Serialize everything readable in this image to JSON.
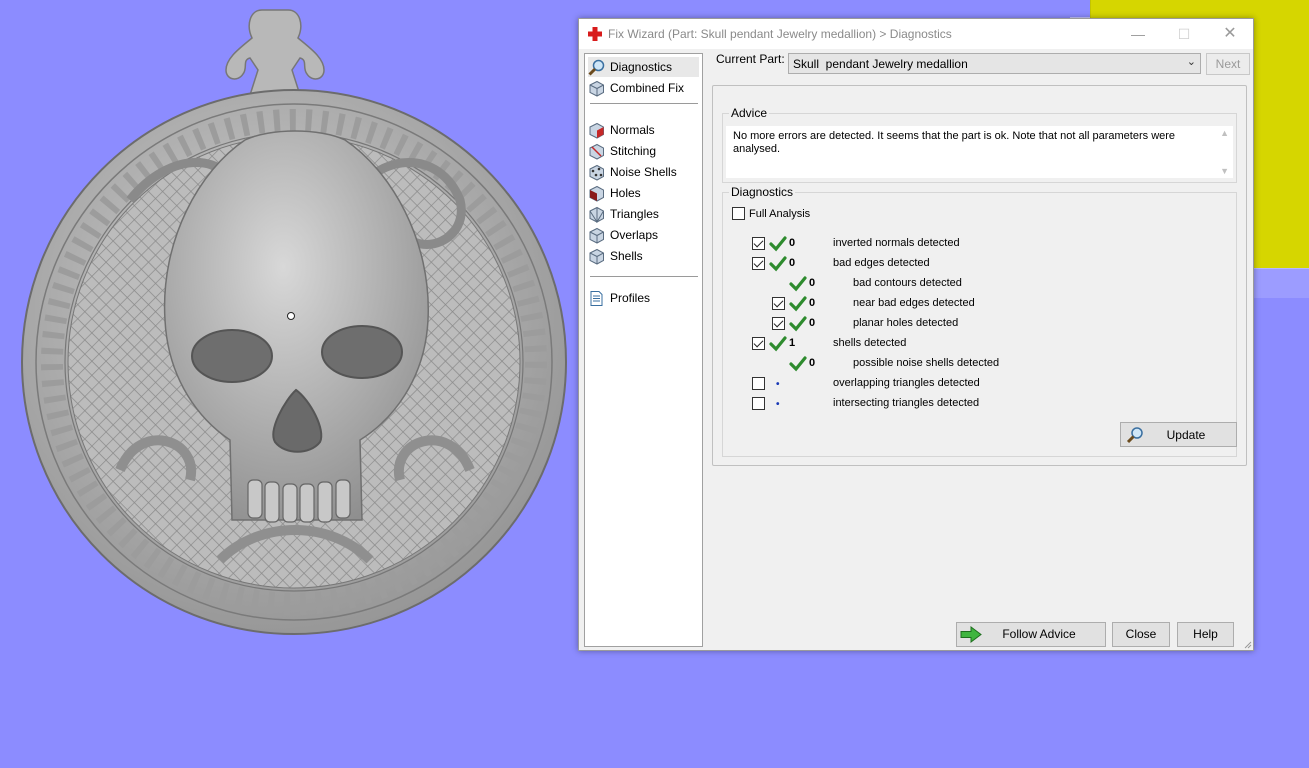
{
  "dialog": {
    "title": "Fix Wizard (Part: Skull  pendant Jewelry medallion) > Diagnostics",
    "current_part_label": "Current Part:",
    "current_part_value": "Skull  pendant Jewelry medallion",
    "next_label": "Next"
  },
  "nav": {
    "items": [
      {
        "label": "Diagnostics"
      },
      {
        "label": "Combined Fix"
      },
      {
        "label": "Normals"
      },
      {
        "label": "Stitching"
      },
      {
        "label": "Noise Shells"
      },
      {
        "label": "Holes"
      },
      {
        "label": "Triangles"
      },
      {
        "label": "Overlaps"
      },
      {
        "label": "Shells"
      },
      {
        "label": "Profiles"
      }
    ]
  },
  "advice": {
    "title": "Advice",
    "text": "No more errors are detected. It seems that the part is ok. Note that not all parameters were analysed."
  },
  "diagnostics": {
    "title": "Diagnostics",
    "full_analysis_label": "Full Analysis",
    "rows": [
      {
        "count": "0",
        "label": "inverted normals detected"
      },
      {
        "count": "0",
        "label": "bad edges detected"
      },
      {
        "count": "0",
        "label": "bad contours detected"
      },
      {
        "count": "0",
        "label": "near bad edges detected"
      },
      {
        "count": "0",
        "label": "planar holes detected"
      },
      {
        "count": "1",
        "label": "shells detected"
      },
      {
        "count": "0",
        "label": "possible noise shells detected"
      },
      {
        "count": "",
        "label": "overlapping triangles detected"
      },
      {
        "count": "",
        "label": "intersecting triangles detected"
      }
    ],
    "update_label": "Update"
  },
  "buttons": {
    "follow_advice": "Follow Advice",
    "close": "Close",
    "help": "Help"
  },
  "colors": {
    "viewport_bg": "#8c8cff",
    "model_gray": "#b4b4b4",
    "check_green": "#2e8b2e",
    "yellow_part": "#d6d600"
  }
}
